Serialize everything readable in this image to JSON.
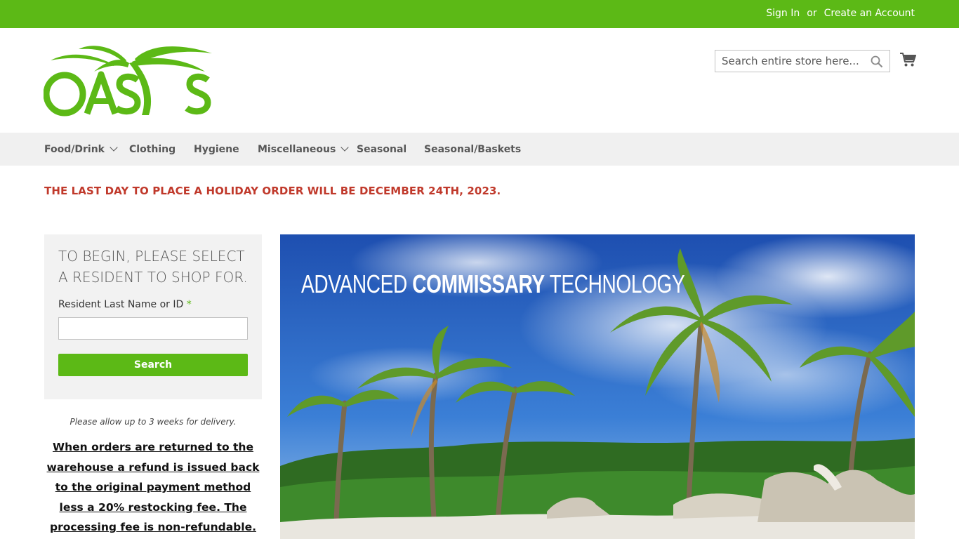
{
  "topbar": {
    "sign_in": "Sign In",
    "or": "or",
    "create_account": "Create an Account",
    "color": "#5cb916"
  },
  "header": {
    "logo_text": "OASIS",
    "search_placeholder": "Search entire store here...",
    "icons": [
      "search-icon",
      "cart-icon"
    ]
  },
  "nav": {
    "items": [
      {
        "label": "Food/Drink",
        "has_submenu": true
      },
      {
        "label": "Clothing",
        "has_submenu": false
      },
      {
        "label": "Hygiene",
        "has_submenu": false
      },
      {
        "label": "Miscellaneous",
        "has_submenu": true
      },
      {
        "label": "Seasonal",
        "has_submenu": false
      },
      {
        "label": "Seasonal/Baskets",
        "has_submenu": false
      }
    ]
  },
  "notice": "THE LAST DAY TO PLACE A HOLIDAY ORDER WILL BE DECEMBER 24TH, 2023.",
  "resident_panel": {
    "title": "TO BEGIN, PLEASE SELECT A RESIDENT TO SHOP FOR.",
    "field_label": "Resident Last Name or ID",
    "required_mark": "*",
    "button_label": "Search"
  },
  "delivery_note": "Please allow up to 3 weeks for delivery.",
  "refund_policy": "When orders are returned to the warehouse a refund is issued back to the original payment method less a 20% restocking fee. The processing fee is non-refundable.",
  "hero": {
    "title_part1": "ADVANCED ",
    "title_part2": "COMMISSARY",
    "title_part3": " TECHNOLOGY"
  }
}
